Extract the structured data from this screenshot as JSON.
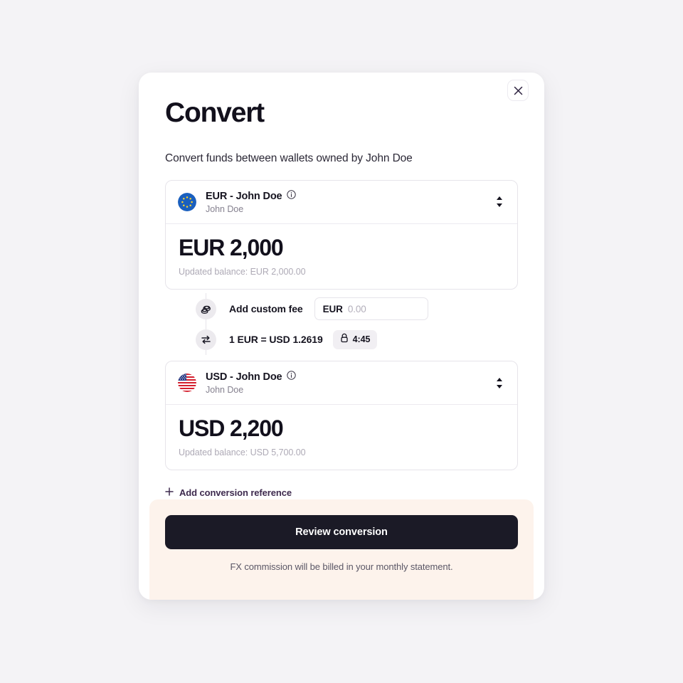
{
  "modal": {
    "title": "Convert",
    "subtitle": "Convert funds between wallets owned by John Doe",
    "close_label": "close-icon"
  },
  "source_wallet": {
    "flag": "eu-flag-icon",
    "title": "EUR - John Doe",
    "owner": "John Doe",
    "info_icon": "info-icon",
    "stepper_icon": "stepper-updown-icon",
    "amount": "EUR 2,000",
    "balance": "Updated balance: EUR 2,000.00"
  },
  "fee": {
    "icon": "coins-icon",
    "label": "Add custom fee",
    "currency": "EUR",
    "value": "",
    "placeholder": "0.00"
  },
  "rate": {
    "icon": "swap-arrows-icon",
    "text": "1 EUR = USD 1.2619",
    "lock_icon": "lock-icon",
    "timer": "4:45"
  },
  "target_wallet": {
    "flag": "us-flag-icon",
    "title": "USD - John Doe",
    "owner": "John Doe",
    "info_icon": "info-icon",
    "stepper_icon": "stepper-updown-icon",
    "amount": "USD 2,200",
    "balance": "Updated balance: USD 5,700.00"
  },
  "reference": {
    "icon": "plus-icon",
    "label": "Add conversion reference"
  },
  "footer": {
    "submit_label": "Review conversion",
    "note": "FX commission will be billed in your monthly statement."
  },
  "colors": {
    "page_background": "#f4f3f6",
    "card_background": "#ffffff",
    "text_primary": "#12101c",
    "text_muted": "#85818f",
    "text_placeholder": "#aeaab6",
    "border": "#e6e4ea",
    "link": "#3e2a4e",
    "banner_background": "#fdf3ec",
    "button_background": "#1b1a26",
    "button_text": "#ffffff"
  }
}
